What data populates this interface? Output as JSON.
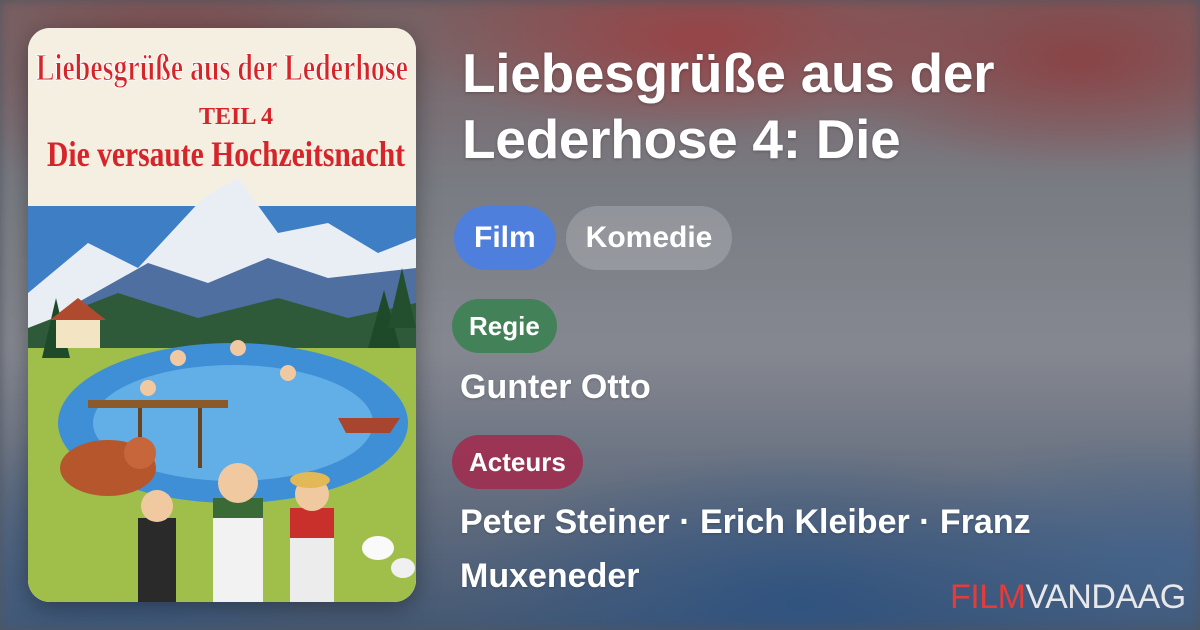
{
  "movie": {
    "title": "Liebesgrüße aus der Lederhose 4: Die",
    "chips": [
      {
        "label": "Film",
        "color": "#4f7fdc"
      },
      {
        "label": "Komedie"
      }
    ],
    "director_label": "Regie",
    "director": "Gunter Otto",
    "actors_label": "Acteurs",
    "actors_line1": "Peter Steiner · Erich Kleiber · Franz",
    "actors_line2": "Muxeneder"
  },
  "poster": {
    "title_line1": "Liebesgrüße aus der Lederhose",
    "title_line2": "TEIL 4",
    "title_line3": "Die versaute Hochzeitsnacht"
  },
  "brand": {
    "part1": "FILM",
    "part2": "VANDAAG",
    "accent": "#e43b3b"
  }
}
